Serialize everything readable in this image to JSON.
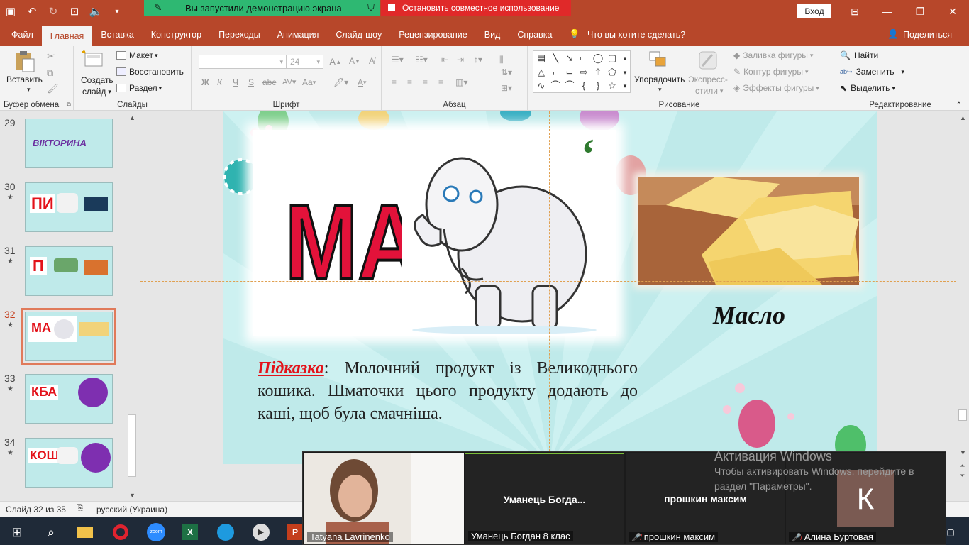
{
  "titlebar": {
    "sharing_status": "Вы запустили демонстрацию экрана",
    "stop_sharing": "Остановить совместное использование",
    "login": "Вход"
  },
  "tabs": [
    "Файл",
    "Главная",
    "Вставка",
    "Конструктор",
    "Переходы",
    "Анимация",
    "Слайд-шоу",
    "Рецензирование",
    "Вид",
    "Справка"
  ],
  "active_tab": "Главная",
  "tell_me": "Что вы хотите сделать?",
  "share": "Поделиться",
  "ribbon": {
    "clipboard": {
      "paste": "Вставить",
      "label": "Буфер обмена"
    },
    "slides": {
      "new_slide_1": "Создать",
      "new_slide_2": "слайд",
      "layout": "Макет",
      "reset": "Восстановить",
      "section": "Раздел",
      "label": "Слайды"
    },
    "font": {
      "size": "24",
      "label": "Шрифт",
      "bold": "Ж",
      "italic": "К",
      "underline": "Ч",
      "strike": "S",
      "aa": "Aa",
      "fontcolor": "A"
    },
    "paragraph": {
      "label": "Абзац"
    },
    "drawing": {
      "arrange_1": "Упорядочить",
      "quick_1": "Экспресс-",
      "quick_2": "стили",
      "fill": "Заливка фигуры",
      "outline": "Контур фигуры",
      "effects": "Эффекты фигуры",
      "label": "Рисование"
    },
    "editing": {
      "find": "Найти",
      "replace": "Заменить",
      "select": "Выделить",
      "label": "Редактирование"
    }
  },
  "thumbnails": [
    {
      "num": "29",
      "star": false,
      "title": "ВІКТОРИНА"
    },
    {
      "num": "30",
      "star": true,
      "title": "ПИ"
    },
    {
      "num": "31",
      "star": true,
      "title": "П"
    },
    {
      "num": "32",
      "star": true,
      "title": "МА"
    },
    {
      "num": "33",
      "star": true,
      "title": "КБА"
    },
    {
      "num": "34",
      "star": true,
      "title": "КОШ"
    }
  ],
  "slide": {
    "syllable": "МА",
    "quote_mark": "‘",
    "word": "Масло",
    "hint_label": "Підказка",
    "hint_text": ": Молочний продукт із Великоднього кошика. Шматочки цього продукту додають до каші, щоб була смачніша."
  },
  "statusbar": {
    "slide_info": "Слайд 32 из 35",
    "language": "русский (Украина)"
  },
  "zoom": {
    "tiles": [
      {
        "footer": "Tatyana Lavrinenko",
        "center": "",
        "muted": false
      },
      {
        "footer": "Уманець Богдан 8 клас",
        "center": "Уманець  Богда...",
        "muted": false
      },
      {
        "footer": "прошкин максим",
        "center": "прошкин максим",
        "muted": true
      },
      {
        "footer": "Алина Буртовая",
        "center": "",
        "muted": true
      }
    ],
    "avatar_letter": "К"
  },
  "activation": {
    "title": "Активация Windows",
    "line1": "Чтобы активировать Windows, перейдите в",
    "line2": "раздел \"Параметры\"."
  },
  "colors": {
    "accent": "#b7472a",
    "green": "#2eb872",
    "red": "#e02929",
    "slide_bg": "#bfeaea"
  }
}
